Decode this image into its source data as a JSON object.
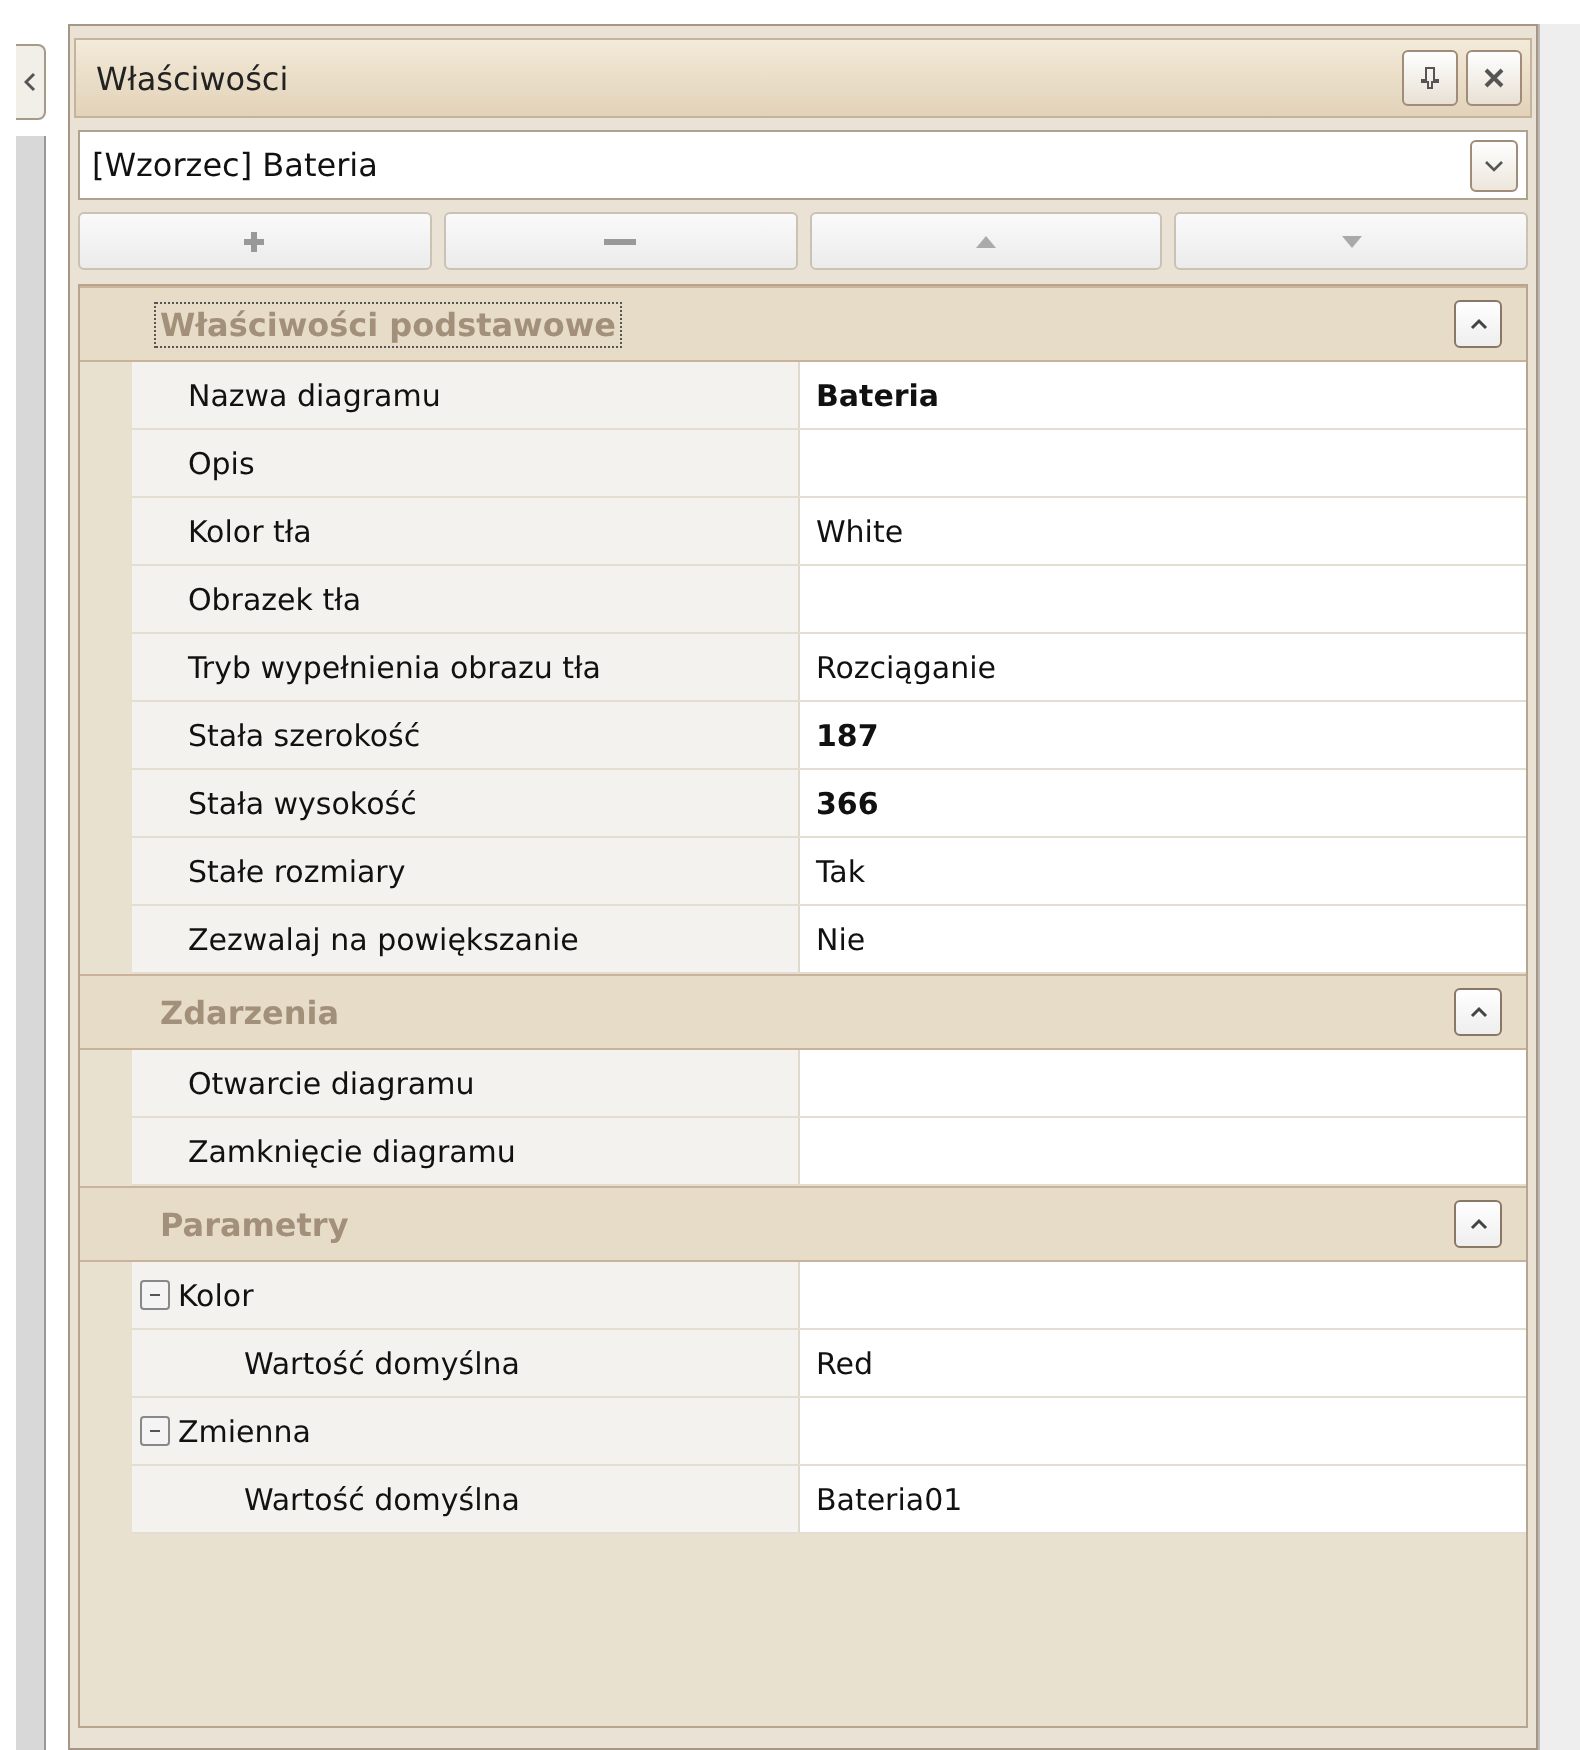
{
  "panel": {
    "title": "Właściwości"
  },
  "object_selector": {
    "value": "[Wzorzec] Bateria"
  },
  "categories": [
    {
      "title": "Właściwości podstawowe",
      "expanded": true,
      "focused": true,
      "properties": [
        {
          "name": "Nazwa diagramu",
          "value": "Bateria",
          "bold": true
        },
        {
          "name": "Opis"
        },
        {
          "name": "Kolor tła",
          "value": "White"
        },
        {
          "name": "Obrazek tła"
        },
        {
          "name": "Tryb wypełnienia obrazu tła",
          "value": "Rozciąganie"
        },
        {
          "name": "Stała szerokość",
          "value": "187",
          "bold": true
        },
        {
          "name": "Stała wysokość",
          "value": "366",
          "bold": true
        },
        {
          "name": "Stałe rozmiary",
          "value": "Tak"
        },
        {
          "name": "Zezwalaj na powiększanie",
          "value": "Nie"
        }
      ]
    },
    {
      "title": "Zdarzenia",
      "expanded": true,
      "focused": false,
      "properties": [
        {
          "name": "Otwarcie diagramu"
        },
        {
          "name": "Zamknięcie diagramu"
        }
      ]
    },
    {
      "title": "Parametry",
      "expanded": true,
      "focused": false,
      "properties": [
        {
          "name": "Kolor",
          "expanded": true,
          "children": [
            {
              "name": "Wartość domyślna",
              "value": "Red"
            }
          ]
        },
        {
          "name": "Zmienna",
          "expanded": true,
          "children": [
            {
              "name": "Wartość domyślna",
              "value": "Bateria01"
            }
          ]
        }
      ]
    }
  ]
}
